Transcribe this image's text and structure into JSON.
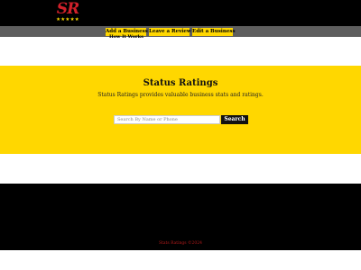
{
  "header": {
    "logo": {
      "letters": "SR",
      "stars": "★★★★★",
      "icon": "status-ratings-logo",
      "letters_color": "#d0202a",
      "stars_color": "#f5d400"
    },
    "nav": {
      "add_business": "Add a Business",
      "how_it_works": "How It Works",
      "leave_review": "Leave a Review",
      "edit_business": "Edit a Business"
    }
  },
  "hero": {
    "title": "Status Ratings",
    "subtitle": "Status Ratings provides valuable business stats and ratings.",
    "background_color": "#ffd700"
  },
  "search": {
    "placeholder": "Search By Name or Phone",
    "button_label": "Search"
  },
  "footer": {
    "copyright": "Stats Ratings ©2024"
  }
}
